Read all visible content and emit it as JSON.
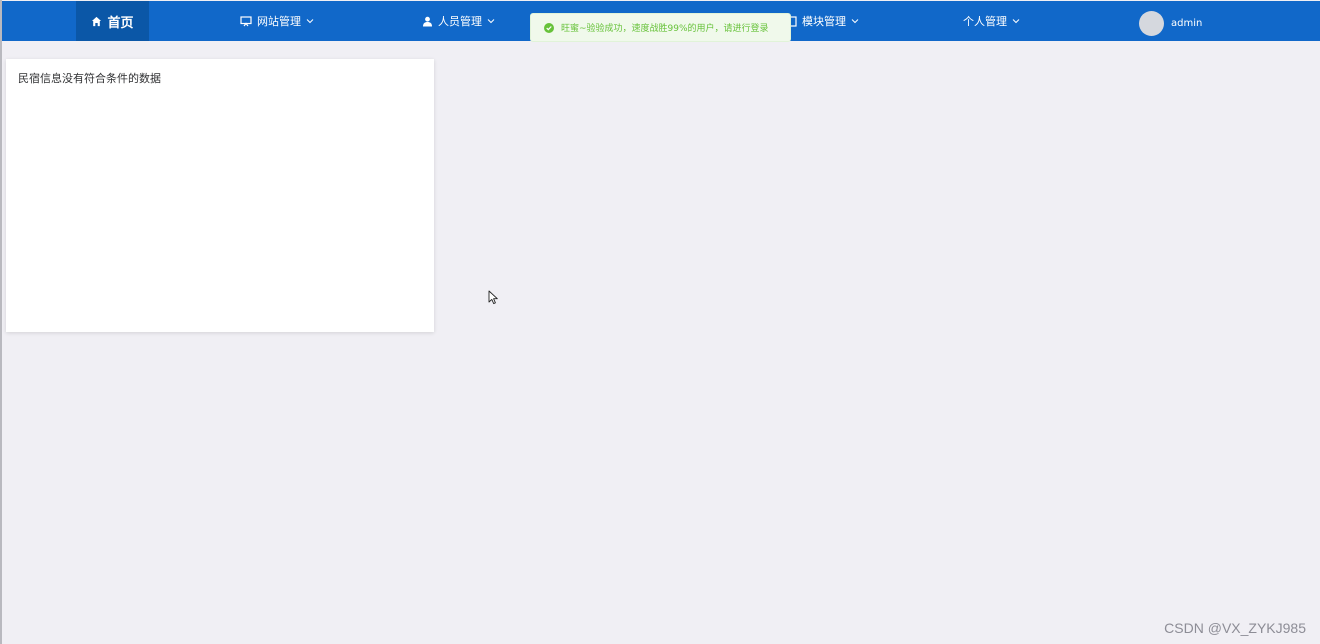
{
  "nav": {
    "home": {
      "label": "首页",
      "icon": "home-icon"
    },
    "site_manage": {
      "label": "网站管理",
      "icon": "monitor-icon"
    },
    "people_manage": {
      "label": "人员管理",
      "icon": "user-icon"
    },
    "module_manage": {
      "label": "模块管理",
      "icon": "module-icon"
    },
    "personal_manage": {
      "label": "个人管理"
    },
    "user": {
      "name": "admin"
    }
  },
  "toast": {
    "type": "success",
    "text": "旺蜜~验验成功，速度战胜99%的用户，请进行登录"
  },
  "card": {
    "empty_text": "民宿信息没有符合条件的数据"
  },
  "watermark": "CSDN @VX_ZYKJ985",
  "colors": {
    "topbar": "#1168c9",
    "active_nav": "#0b57a7",
    "page_bg": "#f0eff4",
    "toast_bg": "#f0f9eb",
    "toast_text": "#67c23a"
  }
}
